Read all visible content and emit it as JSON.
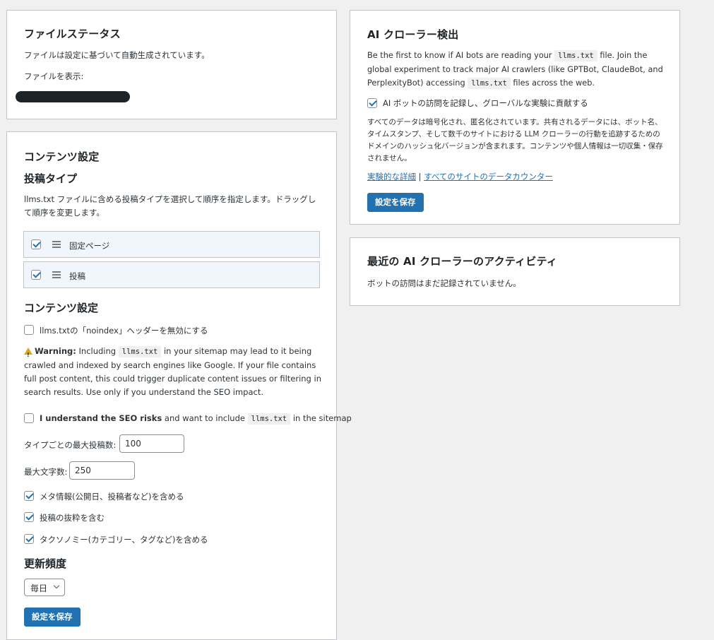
{
  "file_status": {
    "title": "ファイルステータス",
    "description": "ファイルは設定に基づいて自動生成されています。",
    "view_label": "ファイルを表示:"
  },
  "content_settings": {
    "title": "コンテンツ設定",
    "post_types_heading": "投稿タイプ",
    "post_types_desc": "llms.txt ファイルに含める投稿タイプを選択して順序を指定します。ドラッグして順序を変更します。",
    "post_types": [
      {
        "label": "固定ページ",
        "checked": true
      },
      {
        "label": "投稿",
        "checked": true
      }
    ],
    "content_heading": "コンテンツ設定",
    "noindex_label": "llms.txtの「noindex」ヘッダーを無効にする",
    "warning": {
      "strong": "Warning:",
      "text_before": " Including ",
      "code": "llms.txt",
      "text_after": " in your sitemap may lead to it being crawled and indexed by search engines like Google. If your file contains full post content, this could trigger duplicate content issues or filtering in search results. Use only if you understand the SEO impact."
    },
    "seo_risk": {
      "strong": "I understand the SEO risks",
      "text_before": " and want to include ",
      "code": "llms.txt",
      "text_after": " in the sitemap"
    },
    "max_posts_label": "タイプごとの最大投稿数:",
    "max_posts_value": "100",
    "max_words_label": "最大文字数:",
    "max_words_value": "250",
    "options": [
      {
        "label": "メタ情報(公開日、投稿者など)を含める",
        "checked": true
      },
      {
        "label": "投稿の抜粋を含む",
        "checked": true
      },
      {
        "label": "タクソノミー(カテゴリー、タグなど)を含める",
        "checked": true
      }
    ],
    "frequency_heading": "更新頻度",
    "frequency_value": "毎日",
    "save_label": "設定を保存"
  },
  "ai_crawler": {
    "title": "AI クローラー検出",
    "intro_1": "Be the first to know if AI bots are reading your ",
    "intro_code_1": "llms.txt",
    "intro_2": " file. Join the global experiment to track major AI crawlers (like GPTBot, ClaudeBot, and PerplexityBot) accessing ",
    "intro_code_2": "llms.txt",
    "intro_3": " files across the web.",
    "opt_in_label": "AI ボットの訪問を記録し、グローバルな実験に貢献する",
    "privacy_note": "すべてのデータは暗号化され、匿名化されています。共有されるデータには、ボット名、タイムスタンプ、そして数千のサイトにおける LLM クローラーの行動を追跡するためのドメインのハッシュ化バージョンが含まれます。コンテンツや個人情報は一切収集・保存されません。",
    "link_details": "実験的な詳細",
    "link_separator": " | ",
    "link_counter": "すべてのサイトのデータカウンター",
    "save_label": "設定を保存"
  },
  "activity": {
    "title": "最近の AI クローラーのアクティビティ",
    "empty": "ボットの訪問はまだ記録されていません。"
  },
  "colors": {
    "accent": "#2271b1",
    "warning": "#dba617",
    "background": "#f0f0f1"
  }
}
